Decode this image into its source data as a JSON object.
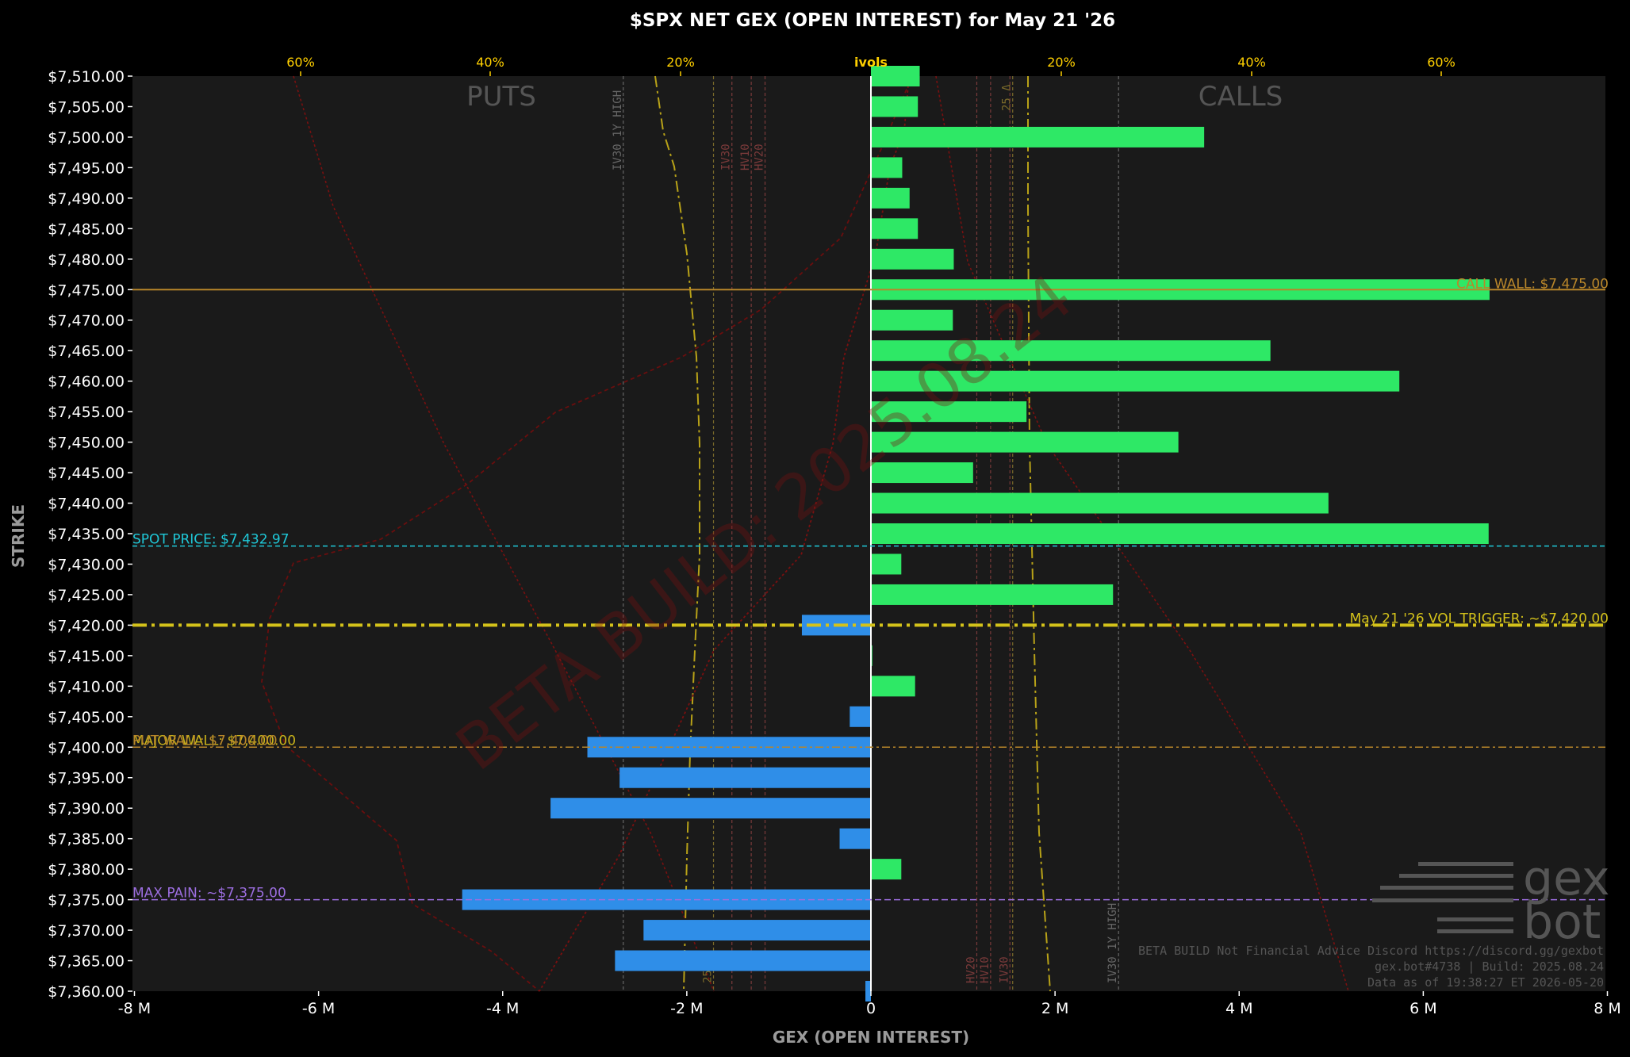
{
  "chart_data": {
    "type": "bar",
    "title": "$SPX NET GEX (OPEN INTEREST) for May 21 '26",
    "xlabel": "GEX (OPEN INTEREST)",
    "ylabel": "STRIKE",
    "top_axis_label": "ivols",
    "top_axis_ticks": [
      "60%",
      "40%",
      "20%",
      "20%",
      "40%",
      "60%"
    ],
    "xlim": [
      -8000000,
      8000000
    ],
    "ylim": [
      7360,
      7510
    ],
    "x_ticks": [
      -8000000,
      -6000000,
      -4000000,
      -2000000,
      0,
      2000000,
      4000000,
      6000000,
      8000000
    ],
    "x_tick_labels": [
      "-8 M",
      "-6 M",
      "-4 M",
      "-2 M",
      "0",
      "2 M",
      "4 M",
      "6 M",
      "8 M"
    ],
    "y_tick_labels": [
      "$7,510.00",
      "$7,505.00",
      "$7,500.00",
      "$7,495.00",
      "$7,490.00",
      "$7,485.00",
      "$7,480.00",
      "$7,475.00",
      "$7,470.00",
      "$7,465.00",
      "$7,460.00",
      "$7,455.00",
      "$7,450.00",
      "$7,445.00",
      "$7,440.00",
      "$7,435.00",
      "$7,430.00",
      "$7,425.00",
      "$7,420.00",
      "$7,415.00",
      "$7,410.00",
      "$7,405.00",
      "$7,400.00",
      "$7,395.00",
      "$7,390.00",
      "$7,385.00",
      "$7,380.00",
      "$7,375.00",
      "$7,370.00",
      "$7,365.00",
      "$7,360.00"
    ],
    "strikes": [
      7510,
      7505,
      7500,
      7495,
      7490,
      7485,
      7480,
      7475,
      7470,
      7465,
      7460,
      7455,
      7450,
      7445,
      7440,
      7435,
      7430,
      7425,
      7420,
      7415,
      7410,
      7405,
      7400,
      7395,
      7390,
      7385,
      7380,
      7375,
      7370,
      7365,
      7360
    ],
    "values": [
      530000,
      510000,
      3620000,
      340000,
      420000,
      510000,
      900000,
      6720000,
      890000,
      4340000,
      5740000,
      1690000,
      3340000,
      1110000,
      4970000,
      6710000,
      330000,
      2630000,
      -750000,
      15000,
      480000,
      -230000,
      -3080000,
      -2730000,
      -3480000,
      -340000,
      330000,
      -4440000,
      -2470000,
      -2780000,
      -60000
    ],
    "positive_color": "#2ee866",
    "negative_color": "#2f8ee8",
    "grid": false,
    "side_labels": {
      "left": "PUTS",
      "right": "CALLS"
    },
    "annotations": {
      "spot": {
        "label": "SPOT PRICE: $7,432.97",
        "value": 7432.97,
        "color": "#1fc8d8"
      },
      "call_wall": {
        "label": "CALL WALL: $7,475.00",
        "value": 7475,
        "color": "#b8862a"
      },
      "vol_trigger": {
        "label": "May 21 '26 VOL TRIGGER: ~$7,420.00",
        "value": 7420,
        "color": "#d4c21a"
      },
      "put_wall": {
        "label": "PUT WALL: $7,400.00",
        "value": 7400,
        "color": "#b8862a"
      },
      "major_wall": {
        "label": "MAJOR WALL: $7,400.00",
        "value": 7400,
        "color": "#c9b31a"
      },
      "max_pain": {
        "label": "MAX PAIN: ~$7,375.00",
        "value": 7375,
        "color": "#9c6ee0"
      }
    },
    "iv_markers": [
      {
        "label": "IV30 1Y HIGH",
        "side": "put",
        "gex_x": -2690000,
        "color": "#666"
      },
      {
        "label": "IV30",
        "side": "put",
        "gex_x": -1510000,
        "color": "#7a3a3a"
      },
      {
        "label": "HV10",
        "side": "put",
        "gex_x": -1300000,
        "color": "#7a3a3a"
      },
      {
        "label": "HV20",
        "side": "put",
        "gex_x": -1150000,
        "color": "#7a3a3a"
      },
      {
        "label": "25 Δ",
        "side": "call",
        "gex_x": 1540000,
        "color": "#7a6a2a"
      },
      {
        "label": "HV20",
        "side": "call",
        "gex_x": 1150000,
        "color": "#7a3a3a"
      },
      {
        "label": "HV10",
        "side": "call",
        "gex_x": 1300000,
        "color": "#7a3a3a"
      },
      {
        "label": "IV30",
        "side": "call",
        "gex_x": 1510000,
        "color": "#7a3a3a"
      },
      {
        "label": "IV30 1Y HIGH",
        "side": "call",
        "gex_x": 2690000,
        "color": "#666"
      },
      {
        "label": "25 Δ",
        "side": "put",
        "gex_x": -1710000,
        "color": "#7a6a2a"
      }
    ],
    "watermark": "BETA BUILD: 2025.08.24",
    "logo": [
      "gex",
      "bot"
    ],
    "footer": [
      "BETA BUILD Not Financial Advice Discord https://discord.gg/gexbot",
      "gex.bot#4738 | Build: 2025.08.24",
      "Data as of 19:38:27 ET 2026-05-20"
    ]
  }
}
